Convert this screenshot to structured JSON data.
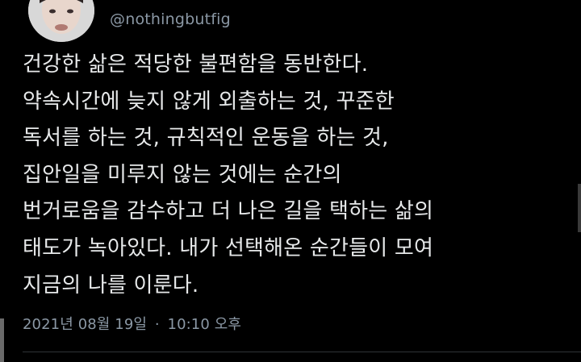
{
  "tweet": {
    "handle": "@nothingbutfig",
    "lines": [
      "건강한 삶은 적당한 불편함을 동반한다.",
      "약속시간에 늦지 않게 외출하는 것, 꾸준한",
      "독서를 하는 것, 규칙적인 운동을 하는 것,",
      "집안일을 미루지 않는 것에는 순간의",
      "번거로움을 감수하고 더 나은 길을 택하는 삶의",
      "태도가 녹아있다. 내가 선택해온 순간들이 모여",
      "지금의 나를 이룬다."
    ],
    "date": "2021년 08월 19일",
    "separator": "·",
    "time": "10:10 오후"
  },
  "colors": {
    "background": "#000000",
    "text": "#e7e9ea",
    "muted": "#8b98a5",
    "divider": "#2f3336"
  }
}
